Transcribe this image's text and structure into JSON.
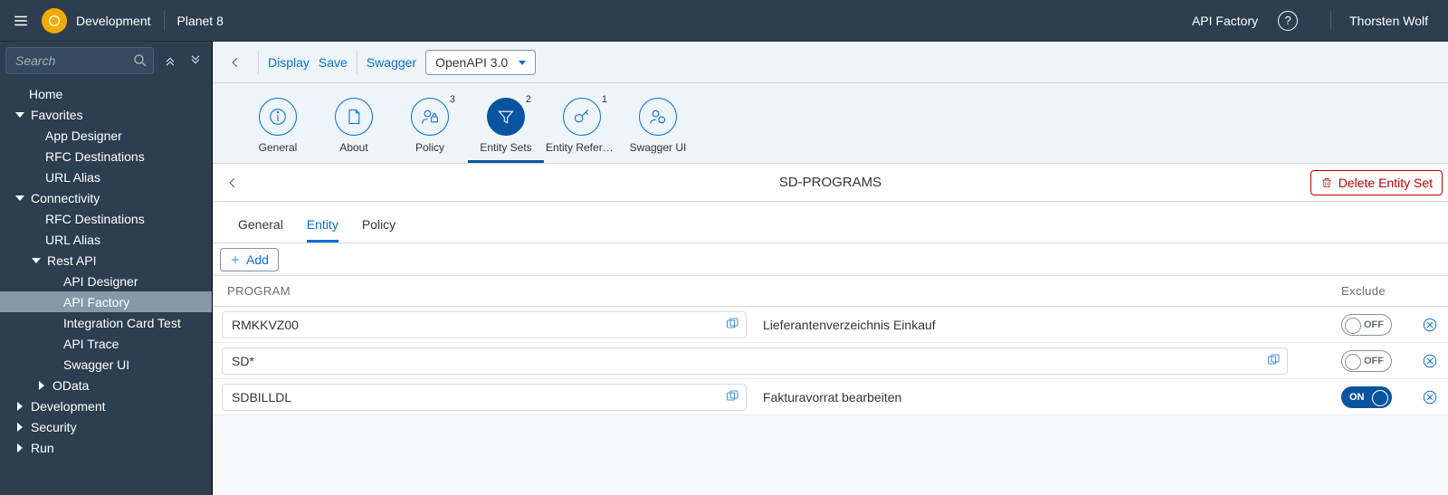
{
  "topbar": {
    "crumb1": "Development",
    "crumb2": "Planet 8",
    "app": "API Factory",
    "user": "Thorsten Wolf"
  },
  "sidebar": {
    "search_placeholder": "Search",
    "tree": {
      "home": "Home",
      "favorites": "Favorites",
      "fav_items": [
        "App Designer",
        "RFC Destinations",
        "URL Alias"
      ],
      "connectivity": "Connectivity",
      "conn_items_a": [
        "RFC Destinations",
        "URL Alias"
      ],
      "rest": "Rest API",
      "rest_items": [
        "API Designer",
        "API Factory",
        "Integration Card Test",
        "API Trace",
        "Swagger UI"
      ],
      "odata": "OData",
      "development": "Development",
      "security": "Security",
      "run": "Run"
    }
  },
  "actionbar": {
    "display": "Display",
    "save": "Save",
    "swagger": "Swagger",
    "spec": "OpenAPI 3.0"
  },
  "sections": {
    "items": [
      {
        "label": "General",
        "badge": ""
      },
      {
        "label": "About",
        "badge": ""
      },
      {
        "label": "Policy",
        "badge": "3"
      },
      {
        "label": "Entity Sets",
        "badge": "2"
      },
      {
        "label": "Entity Refere…",
        "badge": "1"
      },
      {
        "label": "Swagger UI",
        "badge": ""
      }
    ]
  },
  "subheader": {
    "title": "SD-PROGRAMS",
    "delete": "Delete Entity Set"
  },
  "tabs": {
    "general": "General",
    "entity": "Entity",
    "policy": "Policy"
  },
  "add_label": "Add",
  "cols": {
    "program": "PROGRAM",
    "exclude": "Exclude"
  },
  "rows": [
    {
      "program": "RMKKVZ00",
      "desc": "Lieferantenverzeichnis Einkauf",
      "exclude": false,
      "wide": false
    },
    {
      "program": "SD*",
      "desc": "",
      "exclude": false,
      "wide": true
    },
    {
      "program": "SDBILLDL",
      "desc": "Fakturavorrat bearbeiten",
      "exclude": true,
      "wide": false
    }
  ],
  "switch_labels": {
    "on": "ON",
    "off": "OFF"
  }
}
